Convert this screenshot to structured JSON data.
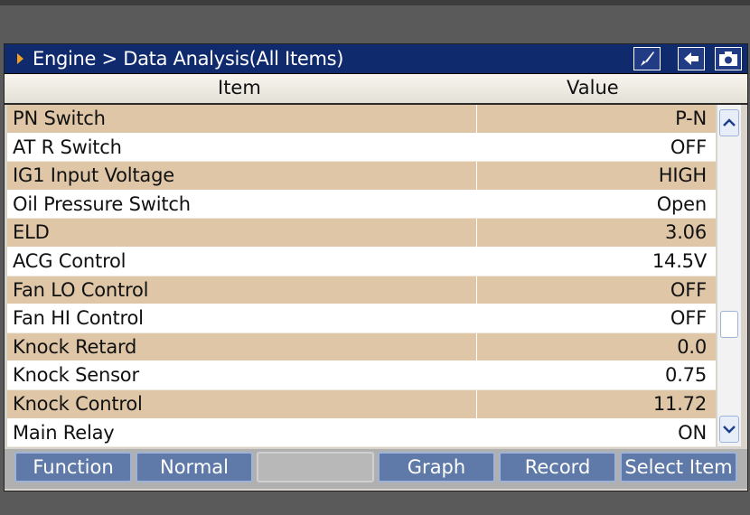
{
  "title": "Engine > Data Analysis(All Items)",
  "toolbar": {
    "icons": [
      "brush-icon",
      "back-arrow-icon",
      "camera-icon"
    ]
  },
  "table": {
    "headers": {
      "item": "Item",
      "value": "Value"
    },
    "rows": [
      {
        "item": "PN Switch",
        "value": "P-N"
      },
      {
        "item": "AT R Switch",
        "value": "OFF"
      },
      {
        "item": "IG1 Input Voltage",
        "value": "HIGH"
      },
      {
        "item": "Oil Pressure Switch",
        "value": "Open"
      },
      {
        "item": "ELD",
        "value": "3.06"
      },
      {
        "item": "ACG Control",
        "value": "14.5V"
      },
      {
        "item": "Fan LO Control",
        "value": "OFF"
      },
      {
        "item": "Fan HI Control",
        "value": "OFF"
      },
      {
        "item": "Knock Retard",
        "value": "0.0"
      },
      {
        "item": "Knock Sensor",
        "value": "0.75"
      },
      {
        "item": "Knock Control",
        "value": "11.72"
      },
      {
        "item": "Main Relay",
        "value": "ON"
      }
    ]
  },
  "footer": {
    "function": "Function",
    "normal": "Normal",
    "blank": "",
    "graph": "Graph",
    "record": "Record",
    "select_item": "Select Item"
  }
}
